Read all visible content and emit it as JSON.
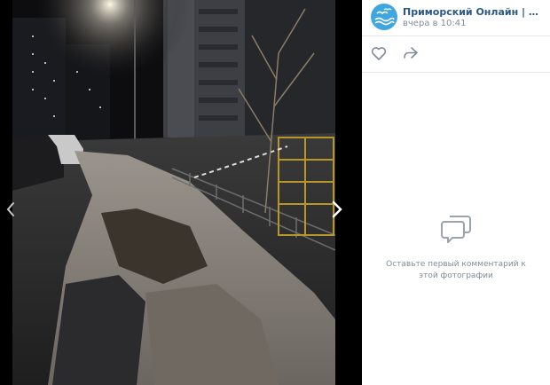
{
  "post": {
    "author": "Приморский Онлайн | Новости н...",
    "time": "вчера в 10:41"
  },
  "comments": {
    "empty_text": "Оставьте первый комментарий к этой фотографии"
  },
  "icons": {
    "prev": "chevron-left-icon",
    "next": "chevron-right-icon",
    "like": "heart-icon",
    "share": "share-arrow-icon",
    "empty": "comment-bubbles-icon"
  },
  "colors": {
    "author_link": "#2a5885",
    "meta_text": "#818c99",
    "avatar_bg": "#3fa7dd"
  }
}
